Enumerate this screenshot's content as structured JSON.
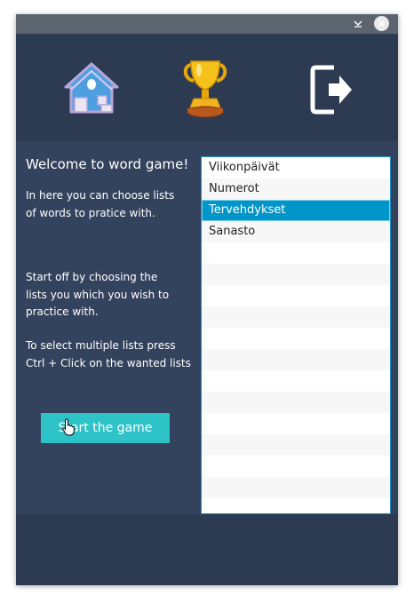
{
  "window": {
    "welcome": "Welcome to word game!",
    "intro": "In here you can choose lists\nof words to pratice with.",
    "instructions": "Start off by choosing the\nlists you which you wish to\npractice with.",
    "multi_select_hint": "To select multiple lists press\nCtrl + Click on the wanted lists",
    "start_button": "Start the game"
  },
  "nav": {
    "home_icon": "home-icon",
    "trophy_icon": "trophy-icon",
    "exit_icon": "exit-icon"
  },
  "word_lists": {
    "items": [
      "Viikonpäivät",
      "Numerot",
      "Tervehdykset",
      "Sanasto"
    ],
    "selected": "Tervehdykset"
  },
  "colors": {
    "header_bg": "#2d3b52",
    "content_bg": "#34435d",
    "accent_button": "#2ec3c6",
    "selection": "#0096c9"
  }
}
